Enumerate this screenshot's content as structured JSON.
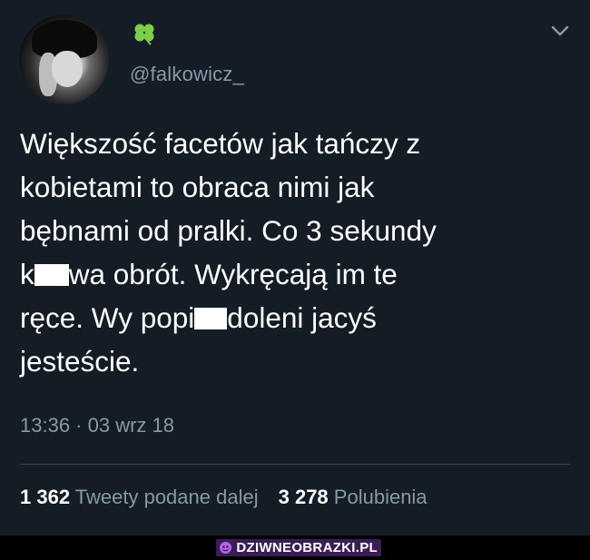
{
  "profile": {
    "handle": "@falkowicz_",
    "avatar_icon": "profile-avatar",
    "badge_icon": "four-leaf-clover-icon"
  },
  "tweet": {
    "line1": "Większość facetów jak tańczy z",
    "line2": "kobietami to obraca nimi jak",
    "line3": "bębnami od pralki. Co 3 sekundy",
    "line4_a": "k",
    "line4_b": "wa obrót. Wykręcają im te",
    "line5_a": "ręce. Wy popi",
    "line5_b": "doleni jacyś",
    "line6": "jesteście.",
    "timestamp": "13:36 · 03 wrz 18"
  },
  "stats": {
    "retweets_count": "1 362",
    "retweets_label": "Tweety podane dalej",
    "likes_count": "3 278",
    "likes_label": "Polubienia"
  },
  "footer": {
    "watermark": "DZIWNEOBRAZKI.PL"
  },
  "colors": {
    "background": "#141d26",
    "text": "#ffffff",
    "muted": "#8899a6",
    "divider": "#38444d"
  }
}
